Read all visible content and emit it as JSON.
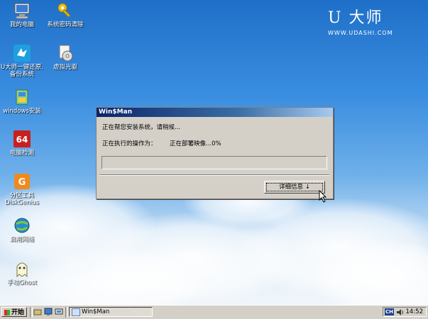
{
  "desktop": {
    "icons": [
      {
        "label": "我的电脑",
        "icon": "computer-icon"
      },
      {
        "label": "系统密码清除",
        "icon": "key-icon"
      },
      {
        "label": "U大师一键还原.备份系统",
        "icon": "bird-icon"
      },
      {
        "label": "虚拟光驱",
        "icon": "cd-drive-icon"
      },
      {
        "label": "windows安装",
        "icon": "installer-icon"
      },
      {
        "label": "电脑检测",
        "icon": "aida64-icon"
      },
      {
        "label": "分区工具DiskGenius",
        "icon": "diskgenius-icon"
      },
      {
        "label": "启用网络",
        "icon": "network-globe-icon"
      },
      {
        "label": "手动Ghost",
        "icon": "ghost-icon"
      }
    ],
    "logo": {
      "title": "U 大师",
      "url": "WWW.UDASHI.COM"
    }
  },
  "dialog": {
    "title": "Win$Man",
    "status": "正在帮您安装系统，请稍候...",
    "operation_label": "正在执行的操作为：",
    "operation_value": "正在部署映像...0%",
    "progress": 0,
    "details_button": "详细信息 ↓"
  },
  "taskbar": {
    "start_label": "开始",
    "task_label": "Win$Man",
    "ime": "CH",
    "clock": "14:52"
  }
}
